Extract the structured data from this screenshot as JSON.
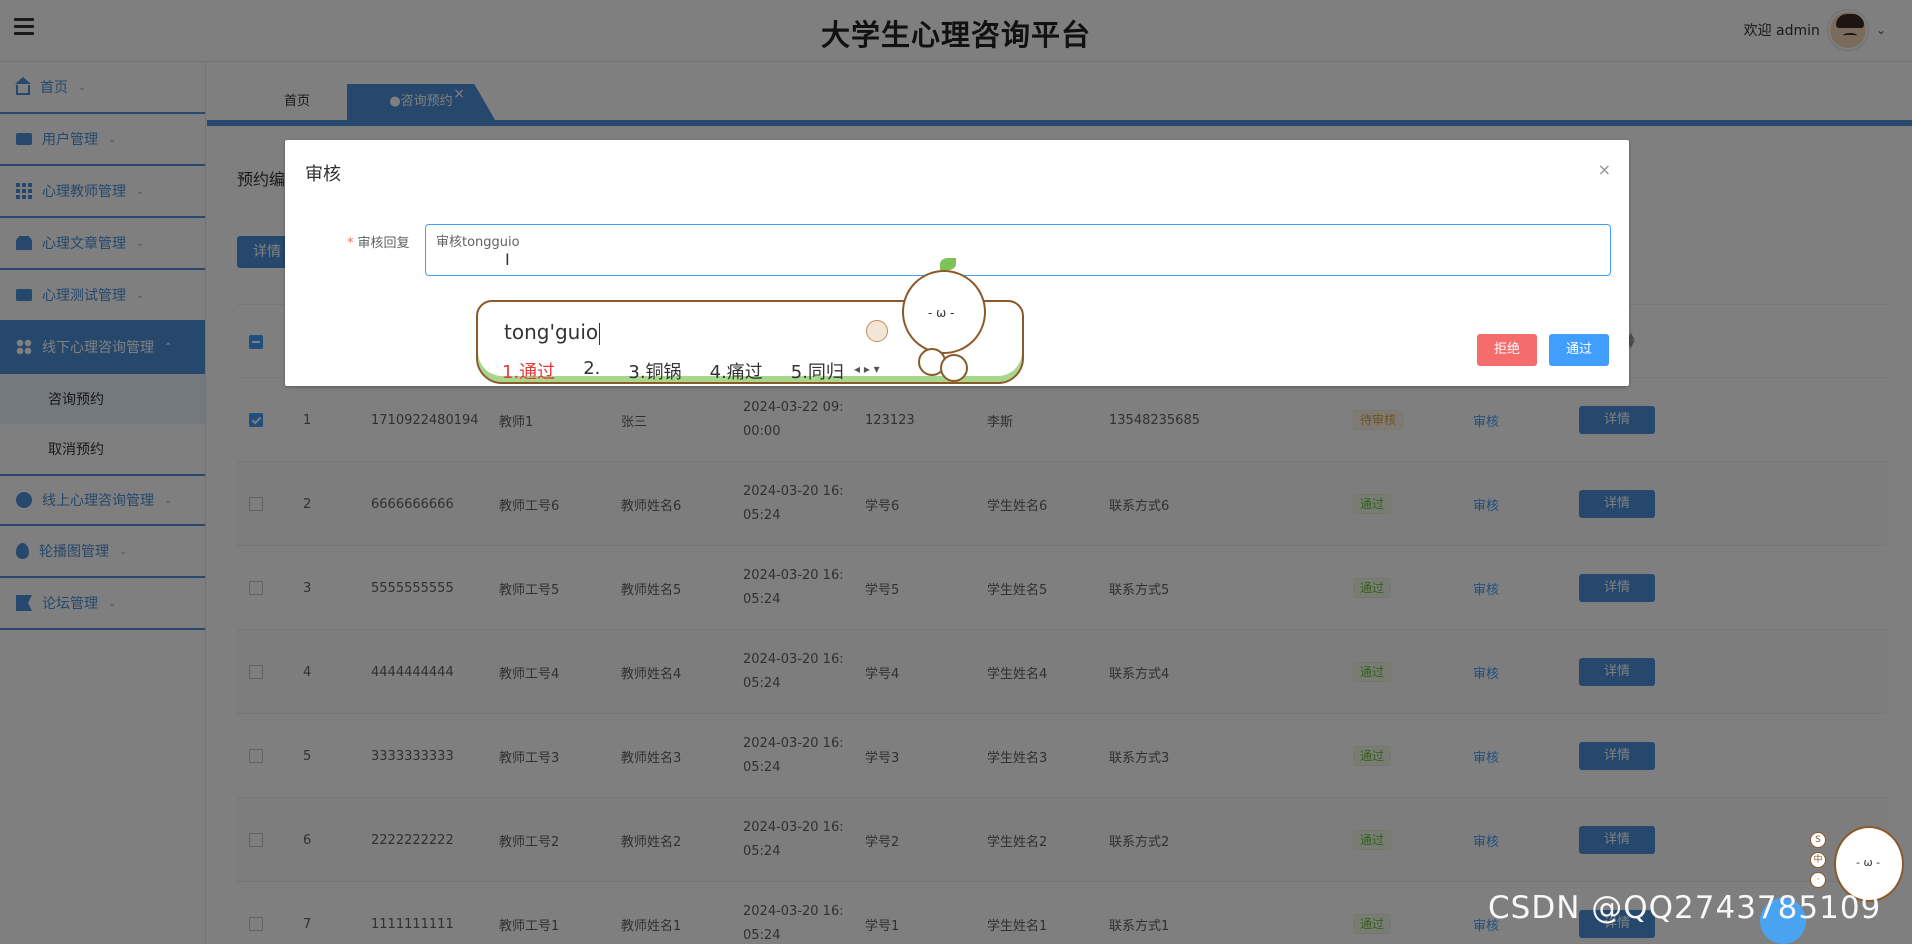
{
  "header": {
    "title": "大学生心理咨询平台",
    "welcome": "欢迎 admin"
  },
  "sidebar": {
    "items": [
      {
        "label": "首页",
        "icon": "home-icon"
      },
      {
        "label": "用户管理",
        "icon": "id-card-icon"
      },
      {
        "label": "心理教师管理",
        "icon": "grid-icon"
      },
      {
        "label": "心理文章管理",
        "icon": "box-icon"
      },
      {
        "label": "心理测试管理",
        "icon": "monitor-icon"
      },
      {
        "label": "线下心理咨询管理",
        "icon": "apps-icon"
      },
      {
        "label": "线上心理咨询管理",
        "icon": "globe-icon"
      },
      {
        "label": "轮播图管理",
        "icon": "drop-icon"
      },
      {
        "label": "论坛管理",
        "icon": "flag-icon"
      }
    ],
    "subitems": [
      "咨询预约",
      "取消预约"
    ]
  },
  "tabs": {
    "home": "首页",
    "active": "●咨询预约",
    "close": "×"
  },
  "content": {
    "filter_label": "预约编",
    "detail_button": "详情"
  },
  "table": {
    "rows": [
      {
        "index": "1",
        "no": "1710922480194",
        "teacher_no": "教师1",
        "teacher_name": "张三",
        "time": "2024-03-22 09:\n00:00",
        "student_no": "123123",
        "student_name": "李斯",
        "contact": "13548235685",
        "status": "待审核",
        "status_type": "pending",
        "checked": true
      },
      {
        "index": "2",
        "no": "6666666666",
        "teacher_no": "教师工号6",
        "teacher_name": "教师姓名6",
        "time": "2024-03-20 16:\n05:24",
        "student_no": "学号6",
        "student_name": "学生姓名6",
        "contact": "联系方式6",
        "status": "通过",
        "status_type": "ok",
        "checked": false
      },
      {
        "index": "3",
        "no": "5555555555",
        "teacher_no": "教师工号5",
        "teacher_name": "教师姓名5",
        "time": "2024-03-20 16:\n05:24",
        "student_no": "学号5",
        "student_name": "学生姓名5",
        "contact": "联系方式5",
        "status": "通过",
        "status_type": "ok",
        "checked": false
      },
      {
        "index": "4",
        "no": "4444444444",
        "teacher_no": "教师工号4",
        "teacher_name": "教师姓名4",
        "time": "2024-03-20 16:\n05:24",
        "student_no": "学号4",
        "student_name": "学生姓名4",
        "contact": "联系方式4",
        "status": "通过",
        "status_type": "ok",
        "checked": false
      },
      {
        "index": "5",
        "no": "3333333333",
        "teacher_no": "教师工号3",
        "teacher_name": "教师姓名3",
        "time": "2024-03-20 16:\n05:24",
        "student_no": "学号3",
        "student_name": "学生姓名3",
        "contact": "联系方式3",
        "status": "通过",
        "status_type": "ok",
        "checked": false
      },
      {
        "index": "6",
        "no": "2222222222",
        "teacher_no": "教师工号2",
        "teacher_name": "教师姓名2",
        "time": "2024-03-20 16:\n05:24",
        "student_no": "学号2",
        "student_name": "学生姓名2",
        "contact": "联系方式2",
        "status": "通过",
        "status_type": "ok",
        "checked": false
      },
      {
        "index": "7",
        "no": "1111111111",
        "teacher_no": "教师工号1",
        "teacher_name": "教师姓名1",
        "time": "2024-03-20 16:\n05:24",
        "student_no": "学号1",
        "student_name": "学生姓名1",
        "contact": "联系方式1",
        "status": "通过",
        "status_type": "ok",
        "checked": false
      }
    ],
    "review_link": "审核",
    "detail_label": "详情"
  },
  "dialog": {
    "title": "审核",
    "close": "×",
    "field_label": "审核回复",
    "required_mark": "*",
    "field_value": "审核tongguio",
    "reject_label": "拒绝",
    "pass_label": "通过"
  },
  "ime": {
    "input": "tong'guio",
    "candidates": [
      "1.通过",
      "2.",
      "3.铜锅",
      "4.痛过",
      "5.同归"
    ],
    "face": "- ω -"
  },
  "watermark": "CSDN @QQ2743785109",
  "corner_dots": [
    "S",
    "中",
    "·"
  ],
  "colors": {
    "primary": "#4a90d9",
    "accent": "#409eff",
    "danger": "#f56c6c",
    "success": "#67c23a",
    "warning": "#e6a23c"
  }
}
